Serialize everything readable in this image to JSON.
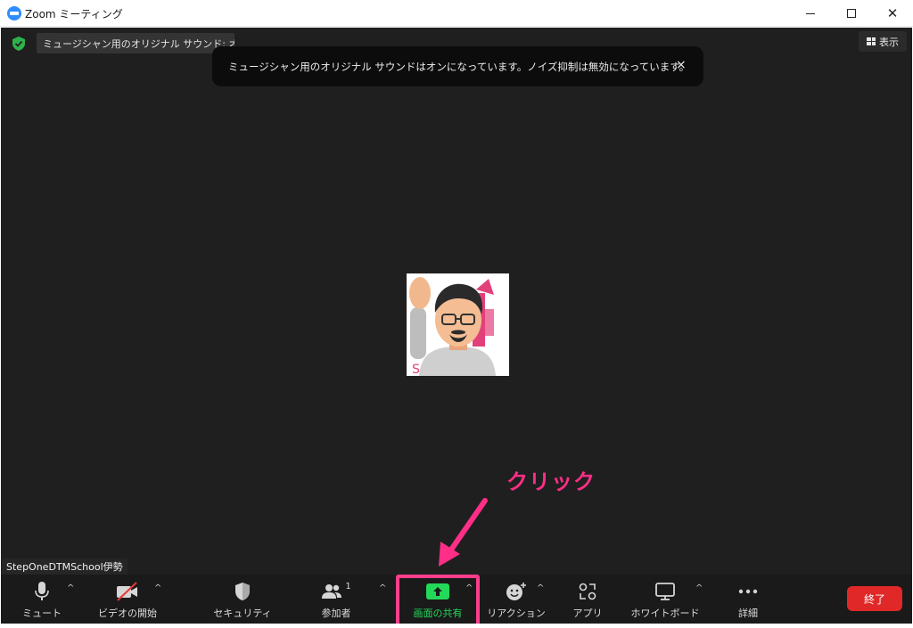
{
  "window": {
    "title": "Zoom ミーティング",
    "minimize_glyph": "—",
    "close_glyph": "✕"
  },
  "meeting": {
    "sound_status": "ミュージシャン用のオリジナル サウンド: オン",
    "view_label": "表示",
    "toast_message": "ミュージシャン用のオリジナル サウンドはオンになっています。ノイズ抑制は無効になっています。",
    "toast_close": "×",
    "participant_name": "StepOneDTMSchool伊勢"
  },
  "toolbar": {
    "mute_label": "ミュート",
    "video_label": "ビデオの開始",
    "security_label": "セキュリティ",
    "participants_label": "参加者",
    "participants_count": "1",
    "share_label": "画面の共有",
    "reaction_label": "リアクション",
    "apps_label": "アプリ",
    "whiteboard_label": "ホワイトボード",
    "more_label": "詳細",
    "end_label": "終了",
    "caret_glyph": "^"
  },
  "annotation": {
    "text": "クリック"
  },
  "colors": {
    "meeting_bg": "#1f1f1f",
    "toolbar_bg": "#1a1a1a",
    "share_green": "#23d959",
    "end_red": "#e02828",
    "annotation_pink": "#ff2e86",
    "shield_green": "#2fb14b"
  }
}
